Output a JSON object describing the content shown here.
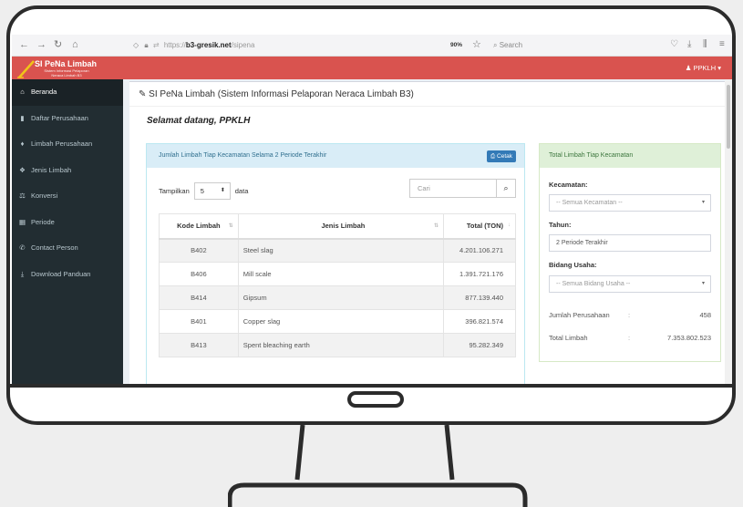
{
  "browser": {
    "back_icon": "arrow-left-icon",
    "url_prefix": "https://",
    "url_domain": "b3-gresik.net",
    "url_path": "/sipena",
    "zoom": "90%",
    "search_placeholder": "Search"
  },
  "header": {
    "logo_title": "SI PeNa Limbah",
    "logo_sub1": "Sistem Informasi Pelaporan",
    "logo_sub2": "Neraca Limbah B3",
    "user": "PPKLH",
    "brand_color": "#d9534f"
  },
  "sidebar": {
    "items": [
      {
        "label": "Beranda",
        "icon": "home-icon"
      },
      {
        "label": "Daftar Perusahaan",
        "icon": "book-icon"
      },
      {
        "label": "Limbah Perusahaan",
        "icon": "flask-icon"
      },
      {
        "label": "Jenis Limbah",
        "icon": "cubes-icon"
      },
      {
        "label": "Konversi",
        "icon": "balance-icon"
      },
      {
        "label": "Periode",
        "icon": "calendar-icon"
      },
      {
        "label": "Contact Person",
        "icon": "phone-icon"
      },
      {
        "label": "Download Panduan",
        "icon": "download-icon"
      }
    ]
  },
  "main": {
    "page_title": "SI PeNa Limbah (Sistem Informasi Pelaporan Neraca Limbah B3)",
    "welcome": "Selamat datang, PPKLH",
    "left_panel": {
      "title": "Jumlah Limbah Tiap Kecamatan Selama 2 Periode Terakhir",
      "print_label": "Cetak",
      "show_label": "Tampilkan",
      "show_value": "5",
      "show_suffix": "data",
      "search_placeholder": "Cari",
      "columns": [
        "Kode Limbah",
        "Jenis Limbah",
        "Total (TON)"
      ],
      "rows": [
        {
          "kode": "B402",
          "jenis": "Steel slag",
          "total": "4.201.106.271"
        },
        {
          "kode": "B406",
          "jenis": "Mill scale",
          "total": "1.391.721.176"
        },
        {
          "kode": "B414",
          "jenis": "Gipsum",
          "total": "877.139.440"
        },
        {
          "kode": "B401",
          "jenis": "Copper slag",
          "total": "396.821.574"
        },
        {
          "kode": "B413",
          "jenis": "Spent bleaching earth",
          "total": "95.282.349"
        }
      ]
    },
    "right_panel": {
      "title": "Total Limbah Tiap Kecamatan",
      "kecamatan_label": "Kecamatan:",
      "kecamatan_value": "-- Semua Kecamatan --",
      "tahun_label": "Tahun:",
      "tahun_value": "2 Periode Terakhir",
      "bidang_label": "Bidang Usaha:",
      "bidang_value": "-- Semua Bidang Usaha --",
      "jumlah_label": "Jumlah Perusahaan",
      "jumlah_value": "458",
      "total_label": "Total Limbah",
      "total_value": "7.353.802.523",
      "colon": ":"
    }
  }
}
